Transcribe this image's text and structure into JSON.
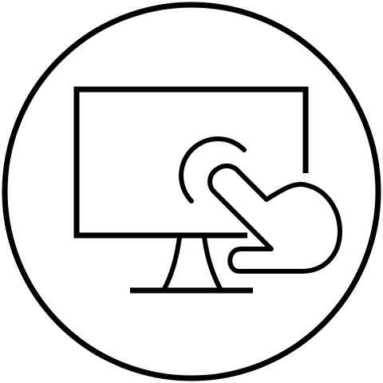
{
  "icon": {
    "name": "touchscreen-monitor-icon",
    "style": "line-art",
    "stroke_color": "#000000",
    "background_color": "#ffffff",
    "elements": [
      "outer-circle",
      "monitor-screen",
      "monitor-stand",
      "monitor-base",
      "touch-ripple-icon",
      "pointing-hand-icon"
    ]
  }
}
